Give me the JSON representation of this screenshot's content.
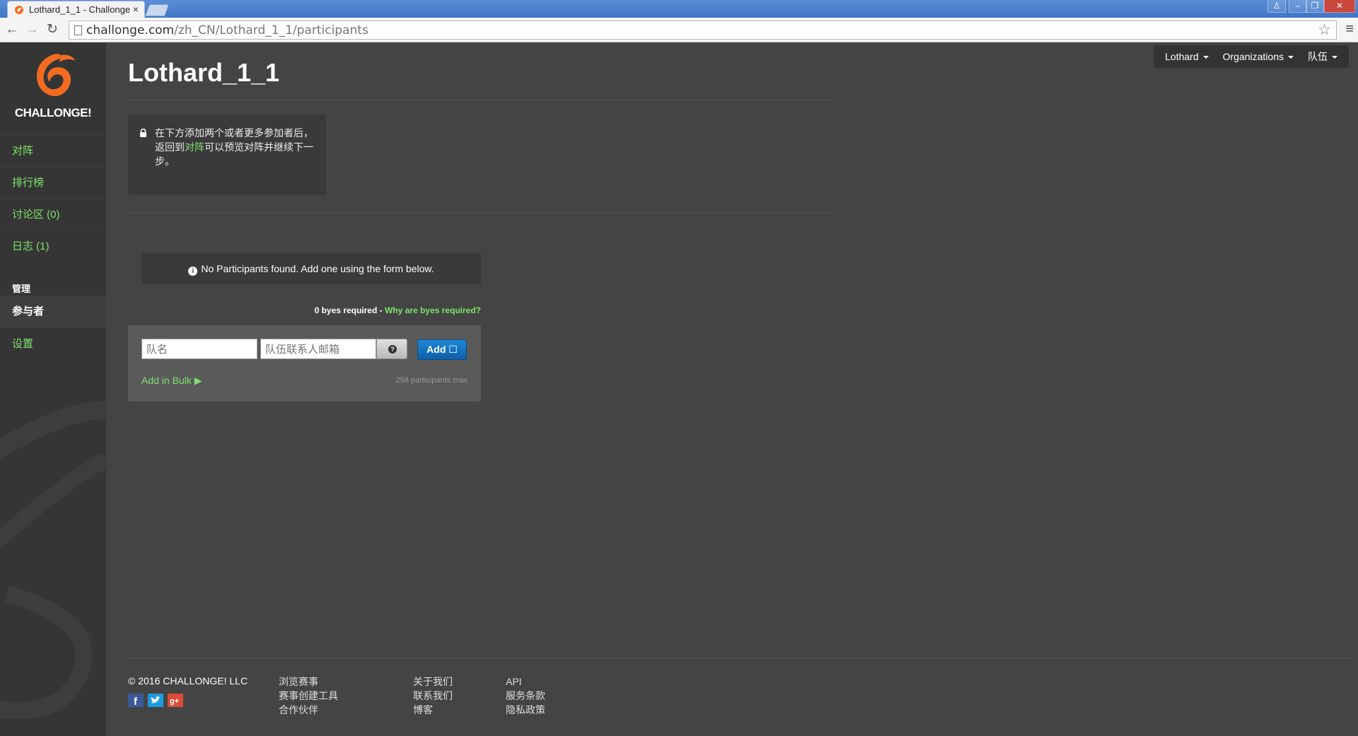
{
  "browser": {
    "tab_title": "Lothard_1_1 - Challonge",
    "tab_close": "×",
    "url_host": "challonge.com",
    "url_path": "/zh_CN/Lothard_1_1/participants",
    "window_buttons": [
      "♙",
      "–",
      "❐",
      "✕"
    ]
  },
  "sidebar": {
    "brand_name": "CHALLONGE!",
    "links": [
      {
        "label": "对阵"
      },
      {
        "label": "排行榜"
      },
      {
        "label": "讨论区 (0)"
      },
      {
        "label": "日志 (1)"
      }
    ],
    "section_title": "管理",
    "admin_links": [
      {
        "label": "参与者",
        "active": true
      },
      {
        "label": "设置"
      }
    ]
  },
  "header": {
    "title": "Lothard_1_1",
    "user_nav": [
      "Lothard",
      "Organizations",
      "队伍"
    ]
  },
  "alert": {
    "text_before": "在下方添加两个或者更多参加者后，返回到",
    "link": "对阵",
    "text_after": "可以预览对阵并继续下一步。"
  },
  "participants": {
    "empty_message": "No Participants found. Add one using the form below.",
    "byes_text": "0 byes required - ",
    "byes_link": "Why are byes required?"
  },
  "form": {
    "name_placeholder": "队名",
    "email_placeholder": "队伍联系人邮箱",
    "add_label": "Add ☐",
    "add_bulk": "Add in Bulk ▶",
    "max_note": "256 participants max"
  },
  "footer": {
    "copyright": "© 2016 CHALLONGE! LLC",
    "col1": [
      "浏览赛事",
      "赛事创建工具",
      "合作伙伴"
    ],
    "col2": [
      "关于我们",
      "联系我们",
      "博客"
    ],
    "col3": [
      "API",
      "服务条款",
      "隐私政策"
    ],
    "social": [
      "f",
      "t",
      "g+"
    ]
  },
  "colors": {
    "accent_green": "#7ee36c",
    "brand_orange": "#f26b21",
    "button_blue": "#1a7ccc"
  }
}
